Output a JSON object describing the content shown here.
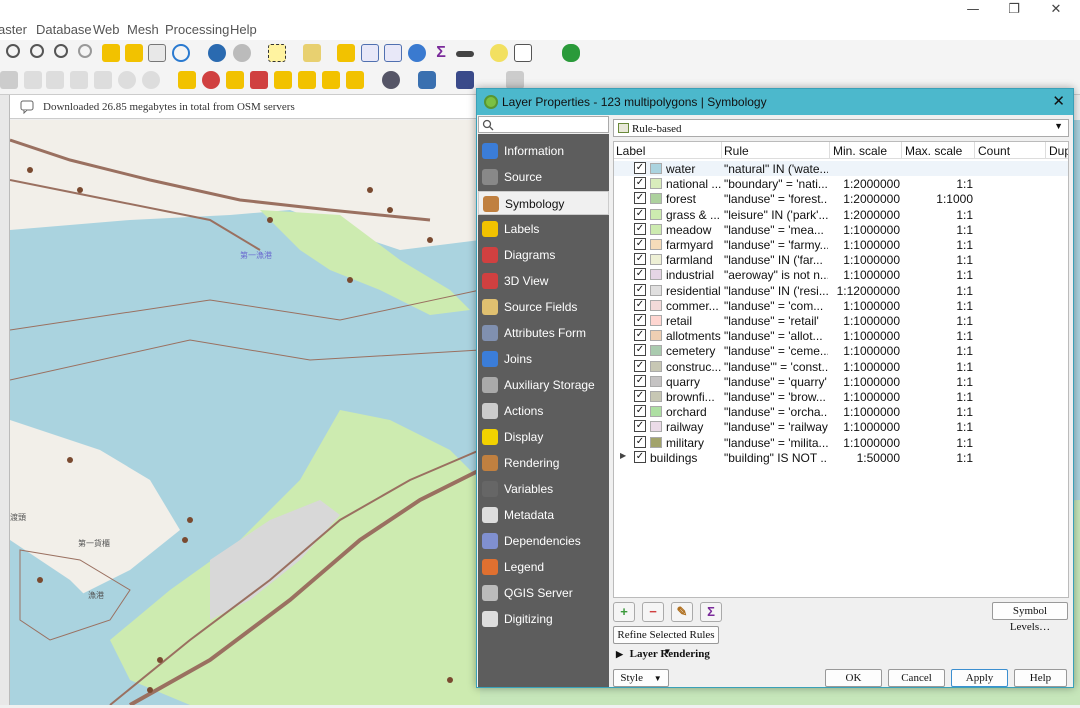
{
  "window": {
    "controls": {
      "minimize": "—",
      "restore": "❐",
      "close": "✕"
    }
  },
  "menubar": {
    "items": [
      "aster",
      "Database",
      "Web",
      "Mesh",
      "Processing",
      "Help"
    ]
  },
  "message_bar": {
    "text": "Downloaded 26.85 megabytes in total from OSM servers"
  },
  "dialog": {
    "title": "Layer Properties - 123 multipolygons | Symbology",
    "close": "✕",
    "search_placeholder": "",
    "nav": [
      {
        "label": "Information",
        "icon": "info-icon",
        "color": "#3b7dd8"
      },
      {
        "label": "Source",
        "icon": "source-icon",
        "color": "#888888"
      },
      {
        "label": "Symbology",
        "icon": "paintbrush-icon",
        "color": "#c08040"
      },
      {
        "label": "Labels",
        "icon": "abc-label-icon",
        "color": "#f2c200"
      },
      {
        "label": "Diagrams",
        "icon": "diagram-icon",
        "color": "#d04040"
      },
      {
        "label": "3D View",
        "icon": "cube-icon",
        "color": "#d04040"
      },
      {
        "label": "Source Fields",
        "icon": "fields-icon",
        "color": "#e0c070"
      },
      {
        "label": "Attributes Form",
        "icon": "form-icon",
        "color": "#8090b0"
      },
      {
        "label": "Joins",
        "icon": "join-icon",
        "color": "#3b7dd8"
      },
      {
        "label": "Auxiliary Storage",
        "icon": "storage-icon",
        "color": "#aaaaaa"
      },
      {
        "label": "Actions",
        "icon": "gear-icon",
        "color": "#cccccc"
      },
      {
        "label": "Display",
        "icon": "speech-bubble-icon",
        "color": "#f2d200"
      },
      {
        "label": "Rendering",
        "icon": "brush-icon",
        "color": "#c08040"
      },
      {
        "label": "Variables",
        "icon": "epsilon-icon",
        "color": "#666666"
      },
      {
        "label": "Metadata",
        "icon": "document-icon",
        "color": "#dddddd"
      },
      {
        "label": "Dependencies",
        "icon": "dependencies-icon",
        "color": "#8090d0"
      },
      {
        "label": "Legend",
        "icon": "legend-icon",
        "color": "#e07030"
      },
      {
        "label": "QGIS Server",
        "icon": "server-icon",
        "color": "#bbbbbb"
      },
      {
        "label": "Digitizing",
        "icon": "digitizing-icon",
        "color": "#dddddd"
      }
    ],
    "active_nav": "Symbology",
    "renderer": {
      "value": "Rule-based",
      "icon": "rule-based-icon"
    },
    "columns": [
      "Label",
      "Rule",
      "Min. scale",
      "Max. scale",
      "Count",
      "Dupl"
    ],
    "rules": [
      {
        "label": "water",
        "rule": "\"natural\" IN ('wate...",
        "min": "",
        "max": "",
        "color": "#aad3df"
      },
      {
        "label": "national ...",
        "rule": "\"boundary\" = 'nati...",
        "min": "1:2000000",
        "max": "1:1",
        "color": "#d9ecbc"
      },
      {
        "label": "forest",
        "rule": "\"landuse\" = 'forest...",
        "min": "1:2000000",
        "max": "1:1000",
        "color": "#add19e"
      },
      {
        "label": "grass & ...",
        "rule": "\"leisure\" IN ('park'...",
        "min": "1:2000000",
        "max": "1:1",
        "color": "#cdebb0"
      },
      {
        "label": "meadow",
        "rule": "\"landuse\" = 'mea...",
        "min": "1:1000000",
        "max": "1:1",
        "color": "#cdebb0"
      },
      {
        "label": "farmyard",
        "rule": "\"landuse\" = 'farmy...",
        "min": "1:1000000",
        "max": "1:1",
        "color": "#f5dcba"
      },
      {
        "label": "farmland",
        "rule": "\"landuse\" IN ('far...",
        "min": "1:1000000",
        "max": "1:1",
        "color": "#eef0d5"
      },
      {
        "label": "industrial",
        "rule": "\"aeroway\" is not n...",
        "min": "1:1000000",
        "max": "1:1",
        "color": "#e5d5e5"
      },
      {
        "label": "residential",
        "rule": "\"landuse\" IN ('resi...",
        "min": "1:12000000",
        "max": "1:1",
        "color": "#e0dfdf"
      },
      {
        "label": "commer...",
        "rule": "\"landuse\" = 'com...",
        "min": "1:1000000",
        "max": "1:1",
        "color": "#f2dad9"
      },
      {
        "label": "retail",
        "rule": "\"landuse\" = 'retail'",
        "min": "1:1000000",
        "max": "1:1",
        "color": "#ffd6d1"
      },
      {
        "label": "allotments",
        "rule": "\"landuse\" = 'allot...",
        "min": "1:1000000",
        "max": "1:1",
        "color": "#eecfb3"
      },
      {
        "label": "cemetery",
        "rule": "\"landuse\" = 'ceme...",
        "min": "1:1000000",
        "max": "1:1",
        "color": "#aacbaf"
      },
      {
        "label": "construc...",
        "rule": "\"landuse'\" = 'const...",
        "min": "1:1000000",
        "max": "1:1",
        "color": "#c7c7b4"
      },
      {
        "label": "quarry",
        "rule": "\"landuse\" = 'quarry'",
        "min": "1:1000000",
        "max": "1:1",
        "color": "#c5c3c3"
      },
      {
        "label": "brownfi...",
        "rule": "\"landuse\" = 'brow...",
        "min": "1:1000000",
        "max": "1:1",
        "color": "#c7c7b4"
      },
      {
        "label": "orchard",
        "rule": "\"landuse\" = 'orcha...",
        "min": "1:1000000",
        "max": "1:1",
        "color": "#aedfa3"
      },
      {
        "label": "railway",
        "rule": "\"landuse\" = 'railway'",
        "min": "1:1000000",
        "max": "1:1",
        "color": "#ebdbe8"
      },
      {
        "label": "military",
        "rule": "\"landuse\" = 'milita...",
        "min": "1:1000000",
        "max": "1:1",
        "color": "#a2a36b"
      },
      {
        "label": "buildings",
        "rule": "\"building\" IS NOT ...",
        "min": "1:50000",
        "max": "1:1",
        "color": "",
        "expandable": true
      }
    ],
    "rule_tools": [
      {
        "name": "add-rule-button",
        "icon": "plus-icon",
        "glyph": "+",
        "color": "#3a9a3a"
      },
      {
        "name": "remove-rule-button",
        "icon": "minus-icon",
        "glyph": "−",
        "color": "#d04040"
      },
      {
        "name": "edit-rule-button",
        "icon": "pencil-icon",
        "glyph": "✎",
        "color": "#b07020"
      },
      {
        "name": "count-features-button",
        "icon": "sigma-icon",
        "glyph": "Σ",
        "color": "#7a2a9a"
      }
    ],
    "symbol_levels": "Symbol Levels…",
    "refine_rules": "Refine Selected Rules",
    "layer_rendering": "Layer Rendering",
    "buttons": {
      "style": "Style",
      "ok": "OK",
      "cancel": "Cancel",
      "apply": "Apply",
      "help": "Help"
    }
  },
  "map": {
    "labels": [
      "第一漁港",
      "第一貨櫃",
      "渡頭",
      "漁港"
    ],
    "colors": {
      "water": "#aad3df",
      "land": "#f2efe9",
      "grass": "#cdebb0",
      "road": "#9a7060",
      "poi": "#7a4a30"
    }
  }
}
